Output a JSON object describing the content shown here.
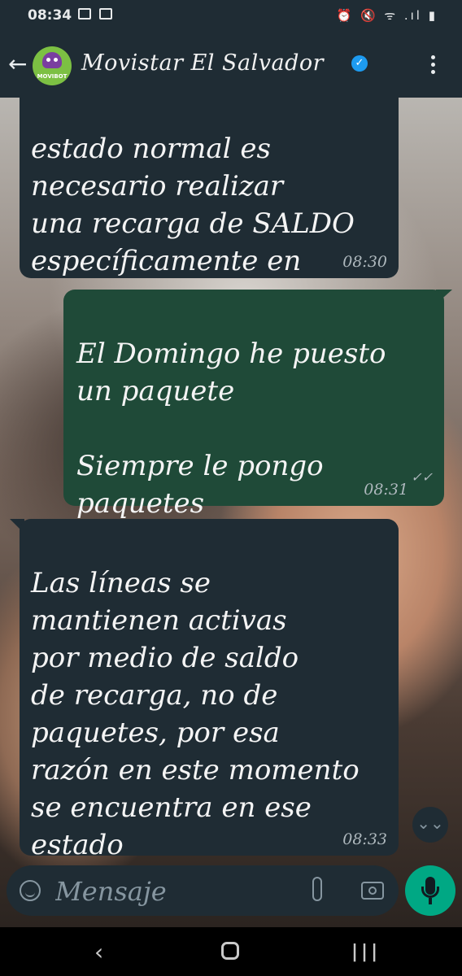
{
  "status_bar": {
    "time": "08:34",
    "right_icons": "⏰ 🔇 ᯤ .ıl ▮"
  },
  "header": {
    "back_glyph": "←",
    "avatar_label": "MOVIBOT",
    "contact_name": "Movistar El Salvador",
    "verified_glyph": "✓"
  },
  "messages": [
    {
      "direction": "incoming",
      "text": "estado normal es\nnecesario realizar\nuna recarga de SALDO\nespecíficamente en\nPUNTOS DE VENTAS",
      "time": "08:30"
    },
    {
      "direction": "outgoing",
      "text": "El Domingo he puesto\nun paquete\n\nSiempre le pongo\npaquetes",
      "time": "08:31",
      "status": "✓✓"
    },
    {
      "direction": "incoming",
      "text": "Las líneas se\nmantienen activas\npor medio de saldo\nde recarga, no de\npaquetes, por esa\nrazón en este momento\nse encuentra en ese\nestado",
      "time": "08:33"
    }
  ],
  "scroll_down_glyph": "⌄⌄",
  "composer": {
    "placeholder": "Mensaje"
  },
  "nav": {
    "back": "‹",
    "recent": "|||"
  },
  "colors": {
    "header_bg": "#1f2c34",
    "incoming_bubble": "#1f2c34",
    "outgoing_bubble": "#1f4a38",
    "mic_button": "#00a884",
    "verified": "#1d9bf0"
  }
}
